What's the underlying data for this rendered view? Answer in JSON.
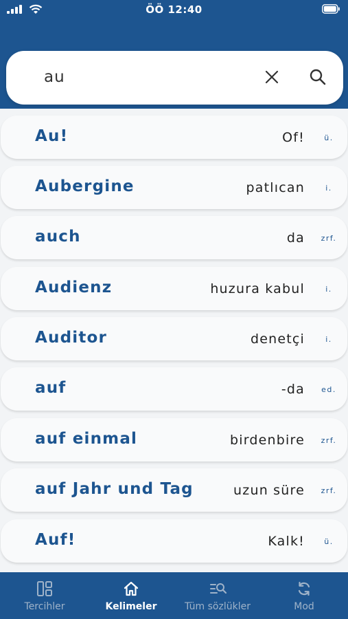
{
  "status_bar": {
    "time": "ÖÖ 12:40"
  },
  "search": {
    "query": "au"
  },
  "results": [
    {
      "word": "Au!",
      "meaning": "Of!",
      "pos": "ü."
    },
    {
      "word": "Aubergine",
      "meaning": "patlıcan",
      "pos": "i."
    },
    {
      "word": "auch",
      "meaning": "da",
      "pos": "zrf."
    },
    {
      "word": "Audienz",
      "meaning": "huzura kabul",
      "pos": "i."
    },
    {
      "word": "Auditor",
      "meaning": "denetçi",
      "pos": "i."
    },
    {
      "word": "auf",
      "meaning": "-da",
      "pos": "ed."
    },
    {
      "word": "auf einmal",
      "meaning": "birdenbire",
      "pos": "zrf."
    },
    {
      "word": "auf Jahr und Tag",
      "meaning": "uzun süre",
      "pos": "zrf."
    },
    {
      "word": "Auf!",
      "meaning": "Kalk!",
      "pos": "ü."
    }
  ],
  "bottom_nav": [
    {
      "label": "Tercihler",
      "icon": "layout-icon"
    },
    {
      "label": "Kelimeler",
      "icon": "home-icon",
      "active": true
    },
    {
      "label": "Tüm sözlükler",
      "icon": "list-search-icon"
    },
    {
      "label": "Mod",
      "icon": "sync-icon"
    }
  ],
  "colors": {
    "primary": "#1d5590",
    "background": "#f2f4f6",
    "card": "#f9fafb"
  }
}
